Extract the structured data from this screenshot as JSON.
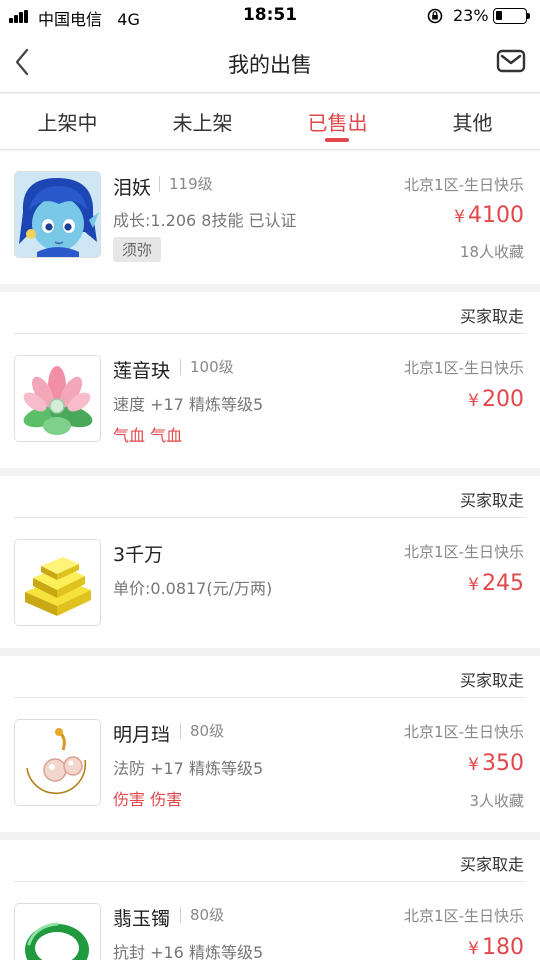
{
  "status_bar": {
    "carrier": "中国电信",
    "network": "4G",
    "time": "18:51",
    "battery_pct_text": "23%",
    "battery_level": 0.23
  },
  "nav": {
    "title": "我的出售",
    "back_icon": "chevron-left-icon",
    "mail_icon": "mail-icon"
  },
  "tabs": [
    {
      "label": "上架中",
      "active": false
    },
    {
      "label": "未上架",
      "active": false
    },
    {
      "label": "已售出",
      "active": true
    },
    {
      "label": "其他",
      "active": false
    }
  ],
  "colors": {
    "accent": "#e2474b",
    "muted": "#888888",
    "background": "#f2f2f2"
  },
  "items": [
    {
      "status": "",
      "icon": "water-spirit-avatar",
      "name": "泪妖",
      "level": "119级",
      "desc": "成长:1.206 8技能 已认证",
      "tag": "须弥",
      "attrs": "",
      "server": "北京1区-生日快乐",
      "currency": "¥",
      "price": "4100",
      "fav": "18人收藏"
    },
    {
      "status": "买家取走",
      "icon": "lotus-pendant-icon",
      "name": "莲音玦",
      "level": "100级",
      "desc": "速度 +17 精炼等级5",
      "tag": "",
      "attrs": "气血 气血",
      "server": "北京1区-生日快乐",
      "currency": "¥",
      "price": "200",
      "fav": ""
    },
    {
      "status": "买家取走",
      "icon": "gold-bars-icon",
      "name": "3千万",
      "level": "",
      "desc": "单价:0.0817(元/万两)",
      "tag": "",
      "attrs": "",
      "server": "北京1区-生日快乐",
      "currency": "¥",
      "price": "245",
      "fav": ""
    },
    {
      "status": "买家取走",
      "icon": "moon-pearl-earring-icon",
      "name": "明月珰",
      "level": "80级",
      "desc": "法防 +17 精炼等级5",
      "tag": "",
      "attrs": "伤害 伤害",
      "server": "北京1区-生日快乐",
      "currency": "¥",
      "price": "350",
      "fav": "3人收藏"
    },
    {
      "status": "买家取走",
      "icon": "jade-bracelet-icon",
      "name": "翡玉镯",
      "level": "80级",
      "desc": "抗封 +16 精炼等级5",
      "tag": "",
      "attrs": "",
      "server": "北京1区-生日快乐",
      "currency": "¥",
      "price": "180",
      "fav": ""
    }
  ]
}
